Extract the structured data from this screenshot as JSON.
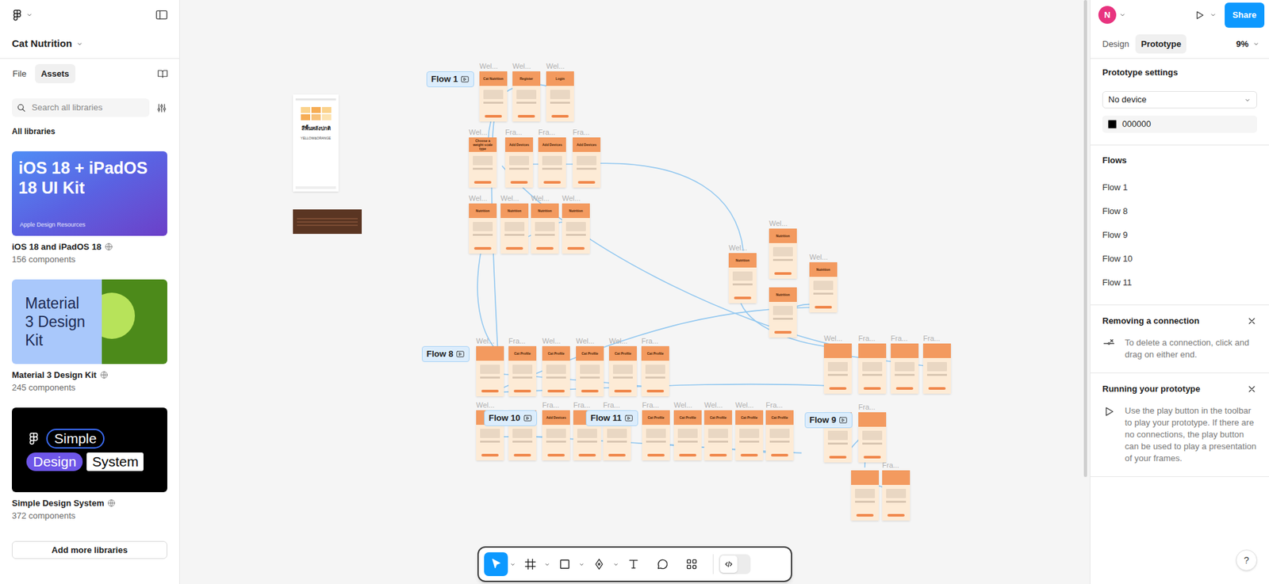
{
  "app": {
    "file_name": "Cat Nutrition"
  },
  "left_panel": {
    "tabs": [
      {
        "label": "File",
        "selected": false
      },
      {
        "label": "Assets",
        "selected": true
      }
    ],
    "search": {
      "placeholder": "Search all libraries"
    },
    "section_title": "All libraries",
    "libraries": [
      {
        "name": "iOS 18 and iPadOS 18",
        "count": "156 components",
        "kind": "ios",
        "thumb_texts": [
          "iOS 18 + iPadOS 18 UI Kit",
          "Apple Design Resources"
        ]
      },
      {
        "name": "Material 3 Design Kit",
        "count": "245 components",
        "kind": "material",
        "thumb_texts": [
          "Material 3 Design Kit"
        ]
      },
      {
        "name": "Simple Design System",
        "count": "372 components",
        "kind": "simple",
        "thumb_texts": [
          "Simple",
          "Design",
          "System"
        ]
      }
    ],
    "add_button": "Add more libraries"
  },
  "right_panel": {
    "avatar": "N",
    "share": "Share",
    "tabs": [
      {
        "label": "Design",
        "selected": false
      },
      {
        "label": "Prototype",
        "selected": true
      }
    ],
    "zoom": "9%",
    "prototype_settings": {
      "title": "Prototype settings",
      "device": "No device",
      "background": "000000"
    },
    "flows_title": "Flows",
    "flows": [
      {
        "label": "Flow 1"
      },
      {
        "label": "Flow 8"
      },
      {
        "label": "Flow 9"
      },
      {
        "label": "Flow 10"
      },
      {
        "label": "Flow 11"
      }
    ],
    "tips": [
      {
        "title": "Removing a connection",
        "text": "To delete a connection, click and drag on either end.",
        "kind": "remove"
      },
      {
        "title": "Running your prototype",
        "text": "Use the play button in the toolbar to play your prototype. If there are no connections, the play button can be used to play a presentation of your frames.",
        "kind": "play"
      }
    ]
  },
  "canvas": {
    "flow_labels": [
      "Flow 1",
      "Flow 8",
      "Flow 10",
      "Flow 11",
      "Flow 9"
    ],
    "frames": [
      {
        "label": "Wel...",
        "title": "Cat Nutrition"
      },
      {
        "label": "Wel...",
        "title": "Register"
      },
      {
        "label": "Wel...",
        "title": "Login"
      },
      {
        "label": "Wel...",
        "title": "Choose a weight scale type"
      },
      {
        "label": "Fra...",
        "title": "Add Devices"
      },
      {
        "label": "Fra...",
        "title": "Add Devices"
      },
      {
        "label": "Fra...",
        "title": "Add Devices"
      },
      {
        "label": "Wel...",
        "title": "Nutrition"
      },
      {
        "label": "Wel...",
        "title": "Nutrition"
      },
      {
        "label": "Wel...",
        "title": "Nutrition"
      },
      {
        "label": "Wel...",
        "title": "Nutrition"
      },
      {
        "label": "Wel...",
        "title": "Nutrition"
      },
      {
        "label": "Wel...",
        "title": "Nutrition"
      },
      {
        "label": "Wel...",
        "title": "Nutrition"
      },
      {
        "title": "Nutrition"
      },
      {
        "label": "Wel..."
      },
      {
        "label": "Fra...",
        "title": "Cat Profile"
      },
      {
        "label": "Wel...",
        "title": "Cat Profile"
      },
      {
        "label": "Wel...",
        "title": "Cat Profile"
      },
      {
        "label": "Wel...",
        "title": "Cat Profile"
      },
      {
        "label": "Fra...",
        "title": "Cat Profile"
      },
      {
        "label": "Wel..."
      },
      {
        "label": "Fra..."
      },
      {
        "label": "Fra..."
      },
      {
        "label": "Fra..."
      },
      {
        "label": "Wel..."
      },
      {},
      {
        "label": "Fra...",
        "title": "Add Devices"
      },
      {
        "label": "Fra..."
      },
      {
        "label": "Fra..."
      },
      {
        "label": "Fra...",
        "title": "Cat Profile"
      },
      {
        "label": "Wel...",
        "title": "Cat Profile"
      },
      {
        "label": "Wel...",
        "title": "Cat Profile"
      },
      {
        "label": "Wel...",
        "title": "Cat Profile"
      },
      {
        "label": "Fra...",
        "title": "Cat Profile"
      },
      {},
      {
        "label": "Fra..."
      },
      {},
      {
        "label": "Fra..."
      }
    ],
    "phone_texts": [
      "สีพื้นหลังปกติ",
      "YELLOW&ORANGE"
    ]
  },
  "toolbar": {
    "tools": [
      {
        "kind": "move",
        "selected": true,
        "dropdown": true
      },
      {
        "kind": "frame",
        "selected": false,
        "dropdown": true
      },
      {
        "kind": "rectangle",
        "selected": false,
        "dropdown": true
      },
      {
        "kind": "pen",
        "selected": false,
        "dropdown": true
      },
      {
        "kind": "text",
        "selected": false,
        "dropdown": false
      },
      {
        "kind": "comment",
        "selected": false,
        "dropdown": false
      },
      {
        "kind": "actions",
        "selected": false,
        "dropdown": false
      }
    ],
    "dev_mode": {
      "on": false
    }
  },
  "help": "?"
}
